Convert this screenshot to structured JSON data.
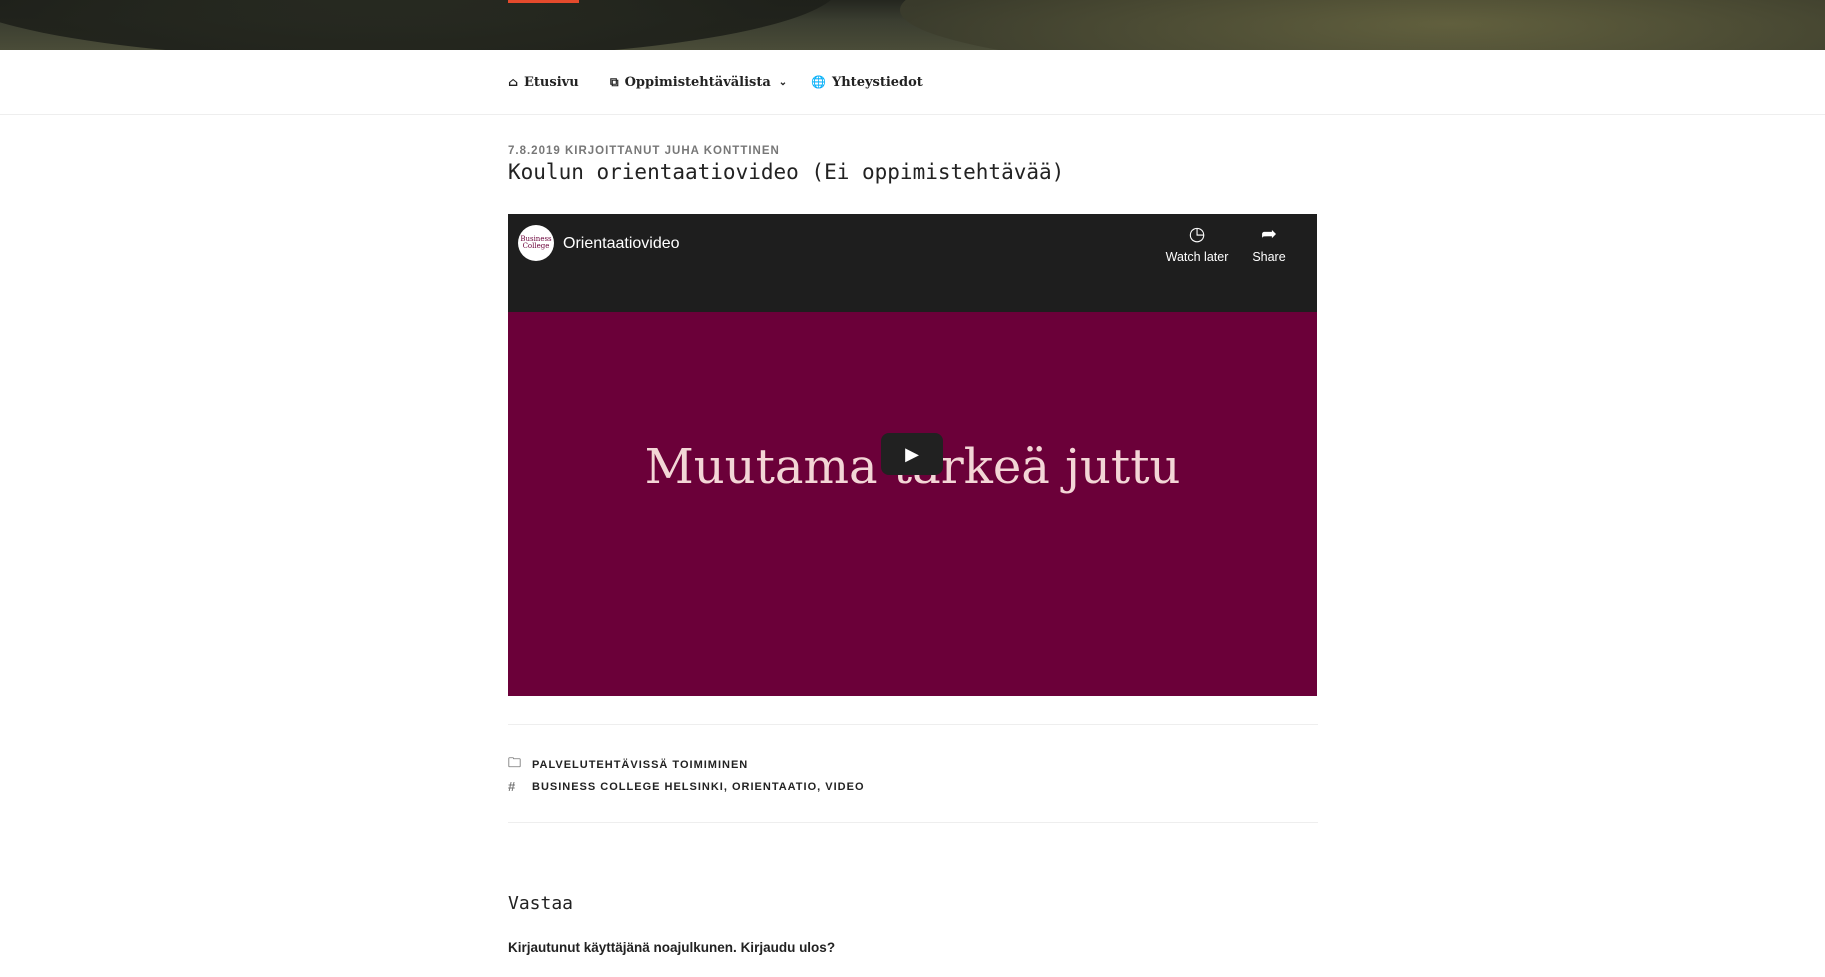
{
  "nav": {
    "items": [
      {
        "label": "Etusivu",
        "icon": "home-icon"
      },
      {
        "label": "Oppimistehtävälista",
        "icon": "copy-icon",
        "has_dropdown": true
      },
      {
        "label": "Yhteystiedot",
        "icon": "globe-icon"
      }
    ]
  },
  "post": {
    "date": "7.8.2019",
    "byline": "KIRJOITTANUT",
    "author": "JUHA KONTTINEN",
    "title": "Koulun orientaatiovideo (Ei oppimistehtävää)"
  },
  "video": {
    "channel_logo_text": "Business College",
    "title": "Orientaatiovideo",
    "watch_later_label": "Watch later",
    "share_label": "Share",
    "slide_text": "Muutama tärkeä juttu",
    "background_color": "#6b0039"
  },
  "taxonomy": {
    "categories": [
      "PALVELUTEHTÄVISSÄ TOIMIMINEN"
    ],
    "tags": [
      "BUSINESS COLLEGE HELSINKI",
      "ORIENTAATIO",
      "VIDEO"
    ]
  },
  "reply": {
    "heading": "Vastaa",
    "logged_in_prefix": "Kirjautunut käyttäjänä noajulkunen.",
    "logout_label": "Kirjaudu ulos?"
  },
  "colors": {
    "accent": "#e44a2c",
    "text": "#222222",
    "muted": "#777777"
  }
}
